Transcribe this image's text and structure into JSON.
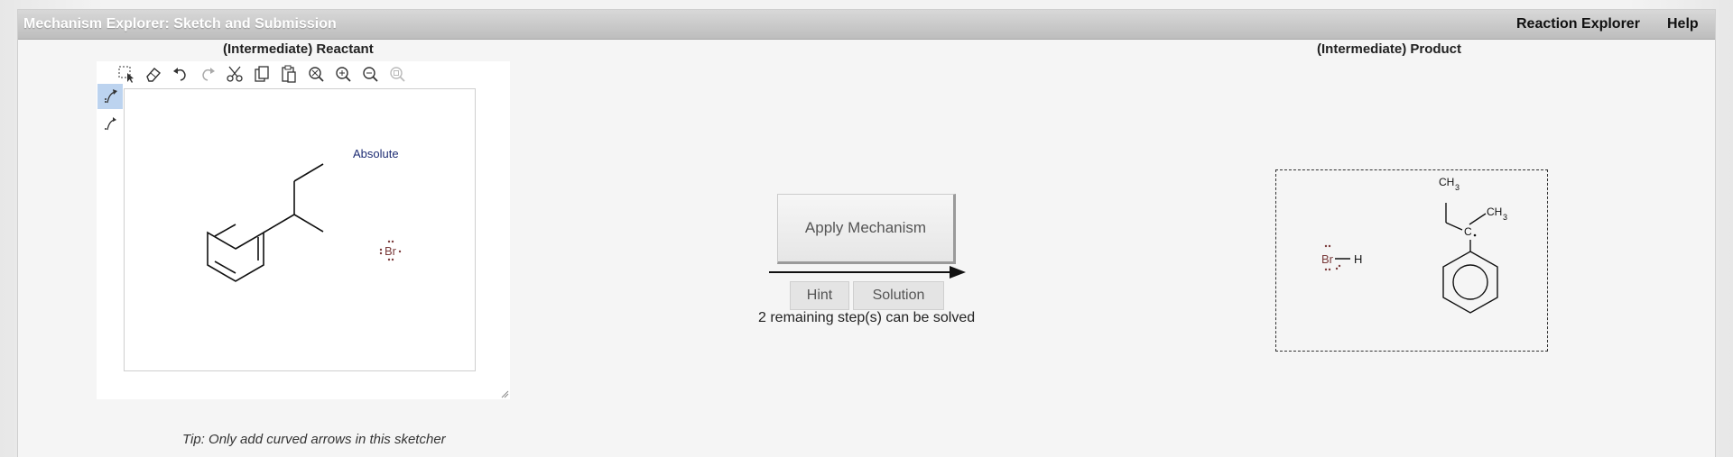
{
  "header": {
    "title": "Mechanism Explorer: Sketch and Submission",
    "links": {
      "reaction_explorer": "Reaction Explorer",
      "help": "Help"
    }
  },
  "reactant": {
    "heading": "(Intermediate) Reactant",
    "toolbar": [
      "select-lasso-icon",
      "eraser-icon",
      "undo-icon",
      "redo-icon",
      "cut-icon",
      "copy-icon",
      "paste-icon",
      "clear-icon",
      "zoom-in-icon",
      "zoom-out-icon",
      "zoom-reset-icon"
    ],
    "side_tools": [
      "electron-pair-arrow-icon",
      "single-electron-arrow-icon"
    ],
    "canvas": {
      "stereo_label": "Absolute",
      "bromine_label": "Br"
    },
    "tip": "Tip: Only add curved arrows in this sketcher"
  },
  "actions": {
    "apply_label": "Apply Mechanism",
    "hint_label": "Hint",
    "solution_label": "Solution",
    "status": "2 remaining step(s) can be solved"
  },
  "product": {
    "heading": "(Intermediate) Product",
    "labels": {
      "hbr_br": "Br",
      "hbr_h": "H",
      "ch3_top_c": "CH",
      "ch3_top_sub": "3",
      "ch3_right_c": "CH",
      "ch3_right_sub": "3",
      "radical_c": "C"
    }
  },
  "colors": {
    "titlebar_text": "#ffffff",
    "stereo_label": "#1d2c73",
    "bromine": "#7a3b3b",
    "active_tool": "#bcd3ef"
  }
}
